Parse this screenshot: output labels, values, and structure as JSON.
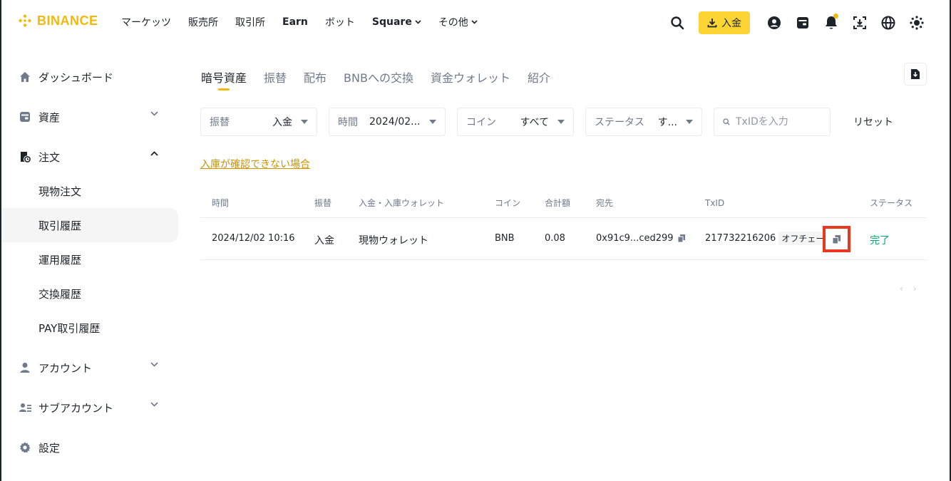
{
  "brand": {
    "name": "BINANCE",
    "color": "#F0B90B"
  },
  "nav": [
    {
      "label": "マーケッツ"
    },
    {
      "label": "販売所"
    },
    {
      "label": "取引所"
    },
    {
      "label": "Earn"
    },
    {
      "label": "ボット"
    },
    {
      "label": "Square"
    },
    {
      "label": "その他"
    }
  ],
  "header": {
    "deposit_label": "入金"
  },
  "sidebar": {
    "items": [
      {
        "label": "ダッシュボード",
        "icon": "home-icon"
      },
      {
        "label": "資産",
        "icon": "wallet-icon"
      },
      {
        "label": "注文",
        "icon": "orders-icon"
      },
      {
        "label": "アカウント",
        "icon": "user-icon"
      },
      {
        "label": "サブアカウント",
        "icon": "sub-account-icon"
      },
      {
        "label": "設定",
        "icon": "gear-icon"
      }
    ],
    "sub_items": [
      {
        "label": "現物注文"
      },
      {
        "label": "取引履歴"
      },
      {
        "label": "運用履歴"
      },
      {
        "label": "交換履歴"
      },
      {
        "label": "PAY取引履歴"
      }
    ]
  },
  "tabs": [
    {
      "label": "暗号資産"
    },
    {
      "label": "振替"
    },
    {
      "label": "配布"
    },
    {
      "label": "BNBへの交換"
    },
    {
      "label": "資金ウォレット"
    },
    {
      "label": "紹介"
    }
  ],
  "filters": {
    "type": {
      "label": "振替",
      "value": "入金"
    },
    "time": {
      "label": "時間",
      "value": "2024/02..."
    },
    "coin": {
      "label": "コイン",
      "value": "すべて"
    },
    "status": {
      "label": "ステータス",
      "value": "す..."
    },
    "search_placeholder": "TxIDを入力",
    "reset_label": "リセット"
  },
  "help_link": "入庫が確認できない場合",
  "table": {
    "headers": [
      "時間",
      "振替",
      "入金・入庫ウォレット",
      "コイン",
      "合計額",
      "宛先",
      "TxID",
      "ステータス"
    ],
    "rows": [
      {
        "time": "2024/12/02 10:16",
        "type": "入金",
        "wallet": "現物ウォレット",
        "coin": "BNB",
        "amount": "0.08",
        "address": "0x91c9...ced299",
        "txid": "217732216206",
        "txid_badge": "オフチェーン",
        "status": "完了"
      }
    ]
  },
  "colors": {
    "accent": "#FCD535",
    "success": "#03A66D",
    "highlight": "#E8391E",
    "link": "#C99400"
  }
}
